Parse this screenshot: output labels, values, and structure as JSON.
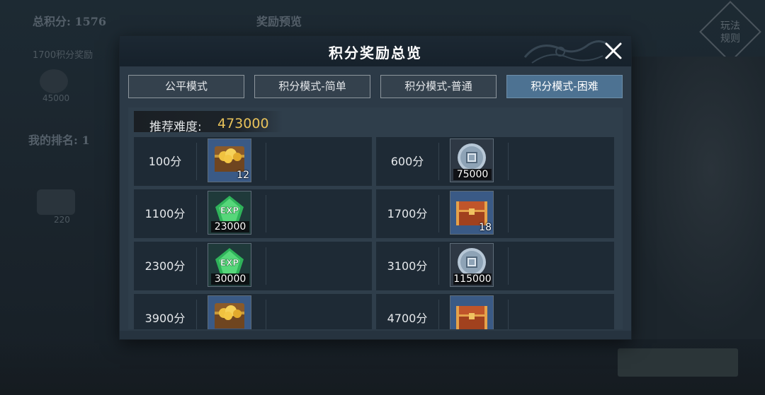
{
  "background": {
    "total_score_label": "总积分: 1576",
    "reward_preview": "奖励预览",
    "row1": "1700积分奖励",
    "icon_count": "45000",
    "my_rank": "我的排名: 1",
    "gift_count": "220",
    "rules_button": "玩法\n规则"
  },
  "modal": {
    "title": "积分奖励总览",
    "tabs": [
      {
        "label": "公平模式",
        "active": false
      },
      {
        "label": "积分模式-简单",
        "active": false
      },
      {
        "label": "积分模式-普通",
        "active": false
      },
      {
        "label": "积分模式-困难",
        "active": true
      }
    ],
    "recommended_label": "推荐难度:",
    "recommended_value": "473000",
    "rewards": [
      {
        "score": "100分",
        "item": "gold-chest-icon",
        "count": "12"
      },
      {
        "score": "600分",
        "item": "coin-icon",
        "count": "75000"
      },
      {
        "score": "1100分",
        "item": "exp-gem-icon",
        "count": "23000"
      },
      {
        "score": "1700分",
        "item": "red-chest-icon",
        "count": "18"
      },
      {
        "score": "2300分",
        "item": "exp-gem-icon",
        "count": "30000"
      },
      {
        "score": "3100分",
        "item": "coin-icon",
        "count": "115000"
      },
      {
        "score": "3900分",
        "item": "gold-chest-icon",
        "count": ""
      },
      {
        "score": "4700分",
        "item": "red-chest-icon",
        "count": ""
      }
    ]
  },
  "colors": {
    "accent_gold": "#e8c25a",
    "active_tab": "#4d7292"
  }
}
